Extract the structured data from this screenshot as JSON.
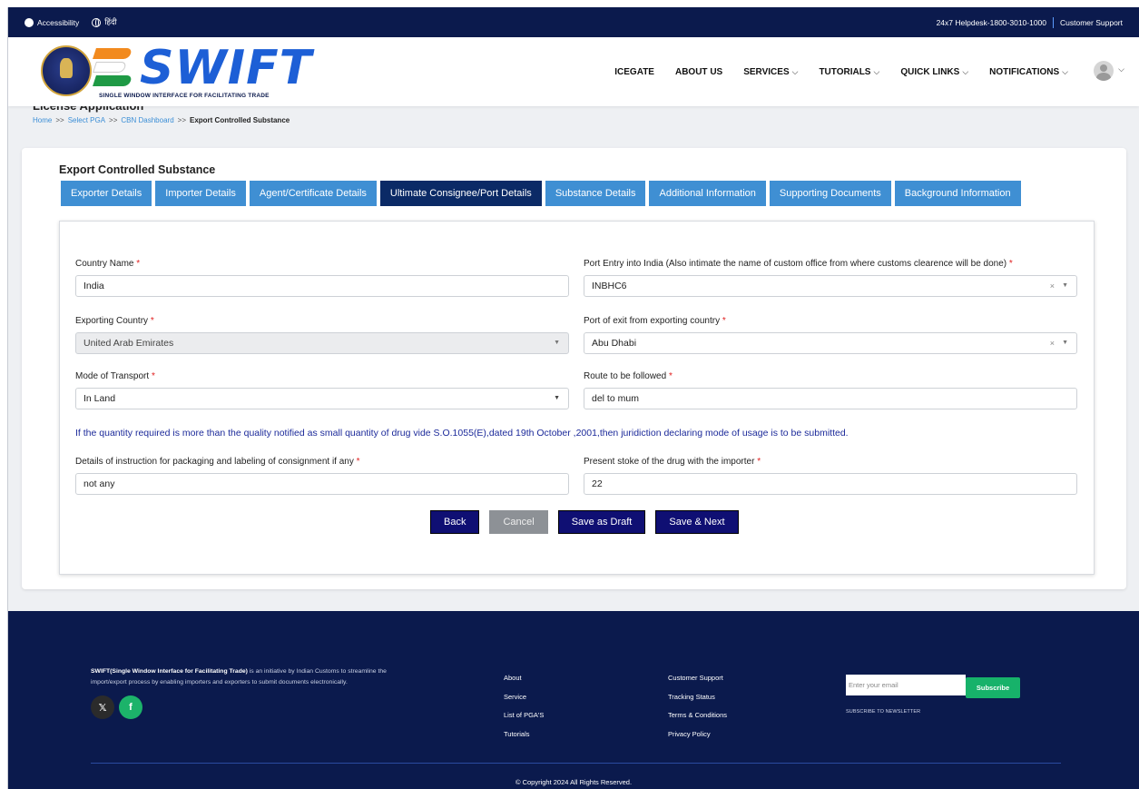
{
  "topbar": {
    "accessibility": "Accessibility",
    "language": "हिंदी",
    "helpdesk": "24x7 Helpdesk-1800-3010-1000",
    "support": "Customer Support"
  },
  "header": {
    "logo_text": "SWIFT",
    "logo_sub": "SINGLE WINDOW INTERFACE FOR FACILITATING TRADE",
    "nav": [
      {
        "label": "ICEGATE"
      },
      {
        "label": "ABOUT US"
      },
      {
        "label": "SERVICES"
      },
      {
        "label": "TUTORIALS"
      },
      {
        "label": "QUICK LINKS"
      },
      {
        "label": "NOTIFICATIONS"
      }
    ]
  },
  "page": {
    "heading": "License Application",
    "breadcrumb": [
      "Home",
      "Select PGA",
      "CBN Dashboard",
      "Export Controlled Substance"
    ]
  },
  "form": {
    "title": "Export Controlled Substance",
    "tabs": [
      "Exporter Details",
      "Importer Details",
      "Agent/Certificate Details",
      "Ultimate Consignee/Port Details",
      "Substance Details",
      "Additional Information",
      "Supporting Documents",
      "Background Information"
    ],
    "active_tab": "Ultimate Consignee/Port Details",
    "fields": {
      "country_name": {
        "label": "Country Name",
        "value": "India"
      },
      "port_entry": {
        "label": "Port Entry into India (Also intimate the name of custom office from where customs clearence will be done)",
        "value": "INBHC6"
      },
      "exporting_country": {
        "label": "Exporting Country",
        "value": "United Arab Emirates"
      },
      "port_exit": {
        "label": "Port of exit from exporting country",
        "value": "Abu Dhabi"
      },
      "mode_of_transport": {
        "label": "Mode of Transport",
        "value": "In Land"
      },
      "route": {
        "label": "Route to be followed",
        "value": "del to mum"
      },
      "packaging": {
        "label": "Details of instruction for packaging and labeling of consignment if any",
        "value": "not any"
      },
      "present_stoke": {
        "label": "Present stoke of the drug with the importer",
        "value": "22"
      }
    },
    "required_mark": "*",
    "clear_glyph": "×",
    "note": "If the quantity required is more than the quality notified as small quantity of drug vide S.O.1055(E),dated 19th October ,2001,then juridiction declaring mode of usage is to be submitted.",
    "buttons": {
      "back": "Back",
      "cancel": "Cancel",
      "save_draft": "Save as Draft",
      "save_next": "Save & Next"
    }
  },
  "footer": {
    "about_bold": "SWIFT(Single Window Interface for Facilitating Trade)",
    "about_rest": " is an initiative by Indian Customs to streamline the import/export process by enabling importers and exporters to submit documents electronically.",
    "col1": [
      "About",
      "Service",
      "List of PGA'S",
      "Tutorials"
    ],
    "col2": [
      "Customer Support",
      "Tracking Status",
      "Terms & Conditions",
      "Privacy Policy"
    ],
    "email_placeholder": "Enter your email",
    "subscribe": "Subscribe",
    "newsletter": "SUBSCRIBE TO NEWSLETTER",
    "copyright": "© Copyright 2024 All Rights Reserved.",
    "social": [
      "x-icon",
      "facebook-icon"
    ]
  },
  "colors": {
    "navy": "#0b1a4d",
    "tab": "#3f8fd3",
    "tab_active": "#0b2a66",
    "button_primary": "#0f0f73",
    "subscribe": "#17b26a"
  }
}
